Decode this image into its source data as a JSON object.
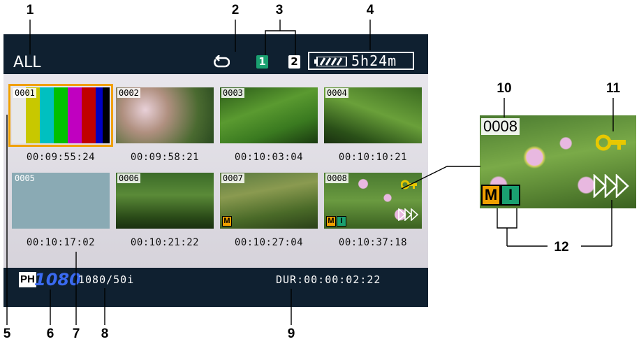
{
  "callouts": [
    "1",
    "2",
    "3",
    "4",
    "5",
    "6",
    "7",
    "8",
    "9",
    "10",
    "11",
    "12"
  ],
  "topbar": {
    "mode": "ALL",
    "repeat_icon": "repeat-icon",
    "slot1": "1",
    "slot2": "2",
    "battery_icon": "battery-icon",
    "battery_remaining": "5h24m"
  },
  "clips": [
    {
      "number": "0001",
      "timecode": "00:09:55:24",
      "selected": true
    },
    {
      "number": "0002",
      "timecode": "00:09:58:21"
    },
    {
      "number": "0003",
      "timecode": "00:10:03:04"
    },
    {
      "number": "0004",
      "timecode": "00:10:10:21"
    },
    {
      "number": "0005",
      "timecode": "00:10:17:02"
    },
    {
      "number": "0006",
      "timecode": "00:10:21:22"
    },
    {
      "number": "0007",
      "timecode": "00:10:27:04",
      "badges": [
        "M"
      ]
    },
    {
      "number": "0008",
      "timecode": "00:10:37:18",
      "badges": [
        "M",
        "I"
      ],
      "protected": true,
      "continued": true
    }
  ],
  "bottombar": {
    "ph": "PH",
    "resolution": "1080",
    "format": "1080/50i",
    "duration": "DUR:00:00:02:22"
  },
  "zoom": {
    "number": "0008",
    "badge_m": "M",
    "badge_i": "I",
    "key_icon": "key-icon",
    "forward_icon": "fast-forward-icon"
  },
  "colors": {
    "screen_bg": "#0f2030",
    "selection": "#f0a000",
    "slot1": "#1aa070",
    "resolution": "#3a6af0"
  }
}
